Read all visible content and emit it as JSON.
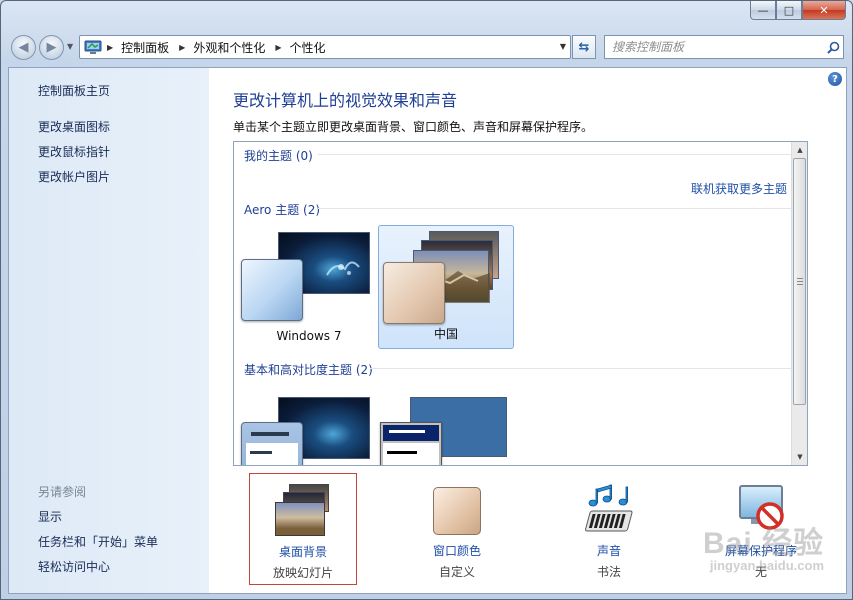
{
  "window": {
    "controls": {
      "minimize": "—",
      "maximize": "□",
      "close": "✕"
    }
  },
  "navbar": {
    "breadcrumbs": [
      "控制面板",
      "外观和个性化",
      "个性化"
    ],
    "search_placeholder": "搜索控制面板"
  },
  "sidebar": {
    "home": "控制面板主页",
    "links": [
      "更改桌面图标",
      "更改鼠标指针",
      "更改帐户图片"
    ],
    "see_also_title": "另请参阅",
    "see_also": [
      "显示",
      "任务栏和「开始」菜单",
      "轻松访问中心"
    ]
  },
  "main": {
    "heading": "更改计算机上的视觉效果和声音",
    "subtitle": "单击某个主题立即更改桌面背景、窗口颜色、声音和屏幕保护程序。",
    "groups": {
      "my_themes": "我的主题 (0)",
      "online_link": "联机获取更多主题",
      "aero": "Aero 主题 (2)",
      "basic": "基本和高对比度主题 (2)"
    },
    "aero_themes": [
      {
        "name": "Windows 7",
        "selected": false
      },
      {
        "name": "中国",
        "selected": true
      }
    ],
    "bottom": [
      {
        "title": "桌面背景",
        "sub": "放映幻灯片",
        "icon": "desktop-background-icon",
        "selected": true
      },
      {
        "title": "窗口颜色",
        "sub": "自定义",
        "icon": "window-color-icon",
        "selected": false
      },
      {
        "title": "声音",
        "sub": "书法",
        "icon": "sounds-icon",
        "selected": false
      },
      {
        "title": "屏幕保护程序",
        "sub": "无",
        "icon": "screensaver-icon",
        "selected": false
      }
    ]
  },
  "watermark": {
    "main": "Bai 经验",
    "sub": "jingyan.baidu.com"
  },
  "colors": {
    "link": "#1e4fa6",
    "heading": "#1e3f94",
    "sidebar_bg": "#dde9f6",
    "selected_theme": "#cfe3fa",
    "selected_border": "#c8413b"
  }
}
